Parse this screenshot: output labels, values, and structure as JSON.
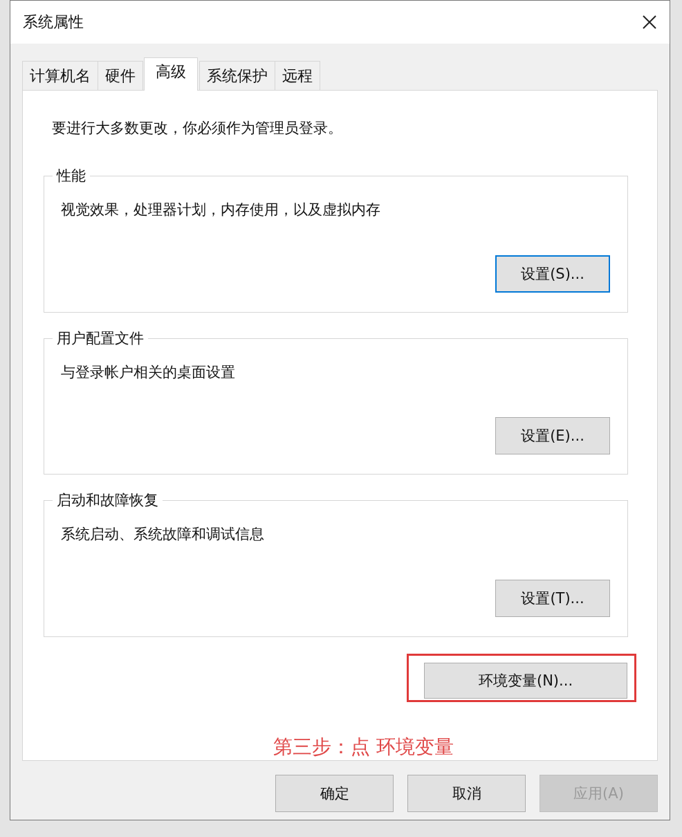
{
  "window": {
    "title": "系统属性"
  },
  "tabs": [
    {
      "label": "计算机名",
      "selected": false
    },
    {
      "label": "硬件",
      "selected": false
    },
    {
      "label": "高级",
      "selected": true
    },
    {
      "label": "系统保护",
      "selected": false
    },
    {
      "label": "远程",
      "selected": false
    }
  ],
  "intro": "要进行大多数更改，你必须作为管理员登录。",
  "groups": [
    {
      "title": "性能",
      "description": "视觉效果，处理器计划，内存使用，以及虚拟内存",
      "button": {
        "label": "设置(S)...",
        "focused": true
      }
    },
    {
      "title": "用户配置文件",
      "description": "与登录帐户相关的桌面设置",
      "button": {
        "label": "设置(E)...",
        "focused": false
      }
    },
    {
      "title": "启动和故障恢复",
      "description": "系统启动、系统故障和调试信息",
      "button": {
        "label": "设置(T)...",
        "focused": false
      }
    }
  ],
  "env_button": {
    "label": "环境变量(N)...",
    "highlighted": true
  },
  "annotation": "第三步：点 环境变量",
  "buttons": [
    {
      "label": "确定",
      "disabled": false
    },
    {
      "label": "取消",
      "disabled": false
    },
    {
      "label": "应用(A)",
      "disabled": true
    }
  ]
}
